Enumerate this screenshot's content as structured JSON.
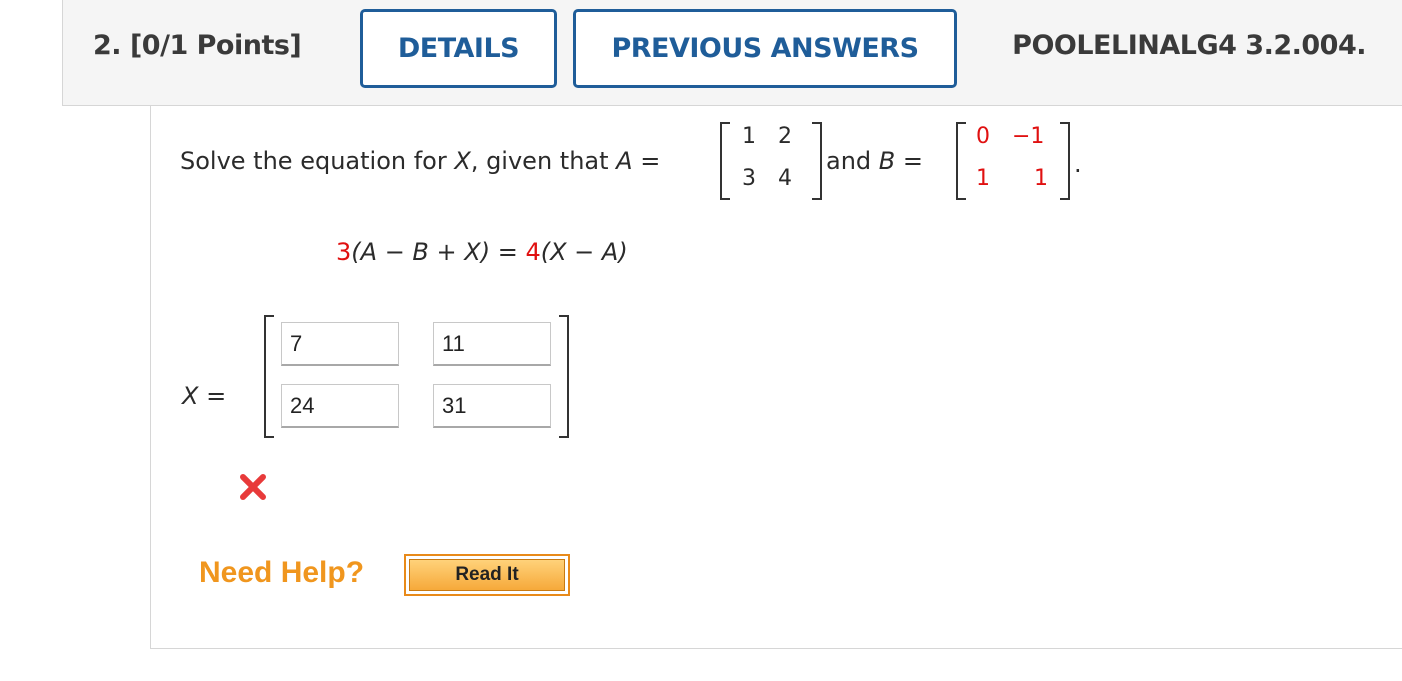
{
  "header": {
    "question_number": "2.",
    "points": "[0/1 Points]",
    "details_label": "DETAILS",
    "previous_answers_label": "PREVIOUS ANSWERS",
    "reference": "POOLELINALG4 3.2.004."
  },
  "problem": {
    "prefix": "Solve the equation for",
    "var_x": "X",
    "given_that": ", given that",
    "var_a": "A",
    "equals": "=",
    "and": "and",
    "var_b": "B",
    "period": ".",
    "matrix_a": [
      [
        "1",
        "2"
      ],
      [
        "3",
        "4"
      ]
    ],
    "matrix_b": [
      [
        "0",
        "−1"
      ],
      [
        "1",
        "1"
      ]
    ]
  },
  "equation": {
    "coef_left": "3",
    "left_rest": "(A − B + X)",
    "eq": "=",
    "coef_right": "4",
    "right_rest": "(X − A)"
  },
  "answer": {
    "label_x": "X",
    "label_eq": "=",
    "inputs": [
      [
        "7",
        "11"
      ],
      [
        "24",
        "31"
      ]
    ],
    "status": "incorrect"
  },
  "help": {
    "need_help": "Need Help?",
    "read_it": "Read It"
  },
  "colors": {
    "accent_blue": "#1f5d99",
    "highlight_red": "#e01010",
    "help_orange": "#f0961e"
  }
}
